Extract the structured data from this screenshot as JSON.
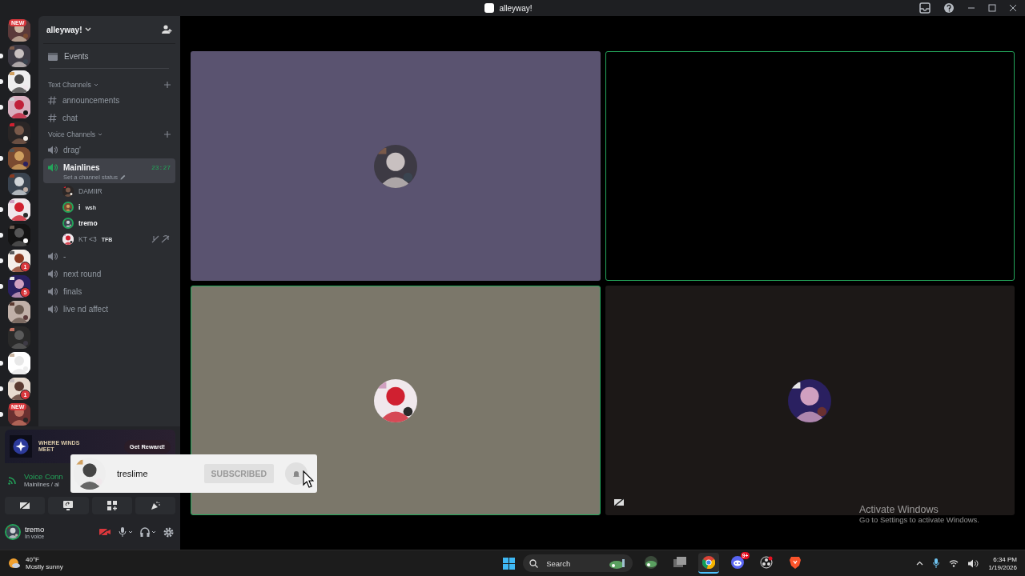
{
  "window": {
    "title": "alleyway!"
  },
  "servers": [
    {
      "badge": {
        "kind": "pill",
        "text": "NEW"
      },
      "unread": false
    },
    {
      "unread": true
    },
    {
      "unread": true
    },
    {
      "unread": true
    },
    {
      "unread": false
    },
    {
      "unread": true
    },
    {
      "unread": false
    },
    {
      "unread": true
    },
    {
      "unread": true
    },
    {
      "badge": {
        "kind": "count",
        "text": "1"
      },
      "unread": true
    },
    {
      "badge": {
        "kind": "count",
        "text": "5"
      },
      "unread": true
    },
    {
      "unread": false
    },
    {
      "unread": false
    },
    {
      "unread": true
    },
    {
      "badge": {
        "kind": "count",
        "text": "1"
      },
      "unread": true
    },
    {
      "badge": {
        "kind": "pill",
        "text": "NEW"
      },
      "unread": true
    }
  ],
  "sidebar": {
    "server_name": "alleyway!",
    "events": "Events",
    "categories": [
      {
        "name": "Text Channels",
        "channels": [
          {
            "kind": "text",
            "name": "announcements",
            "selected": false
          },
          {
            "kind": "text",
            "name": "chat",
            "selected": false
          }
        ]
      },
      {
        "name": "Voice Channels",
        "channels": [
          {
            "kind": "voice",
            "name": "drag'",
            "selected": false
          },
          {
            "kind": "voice",
            "name": "Mainlines",
            "selected": true,
            "timer": "23:27",
            "status": "Set a channel status",
            "members": [
              {
                "name": "DAMIIR",
                "speaking": false,
                "muted": false
              },
              {
                "name": "i",
                "tag": "wsh",
                "speaking": true,
                "muted": false
              },
              {
                "name": "tremo",
                "speaking": true,
                "muted": false
              },
              {
                "name": "KT <3",
                "tag": "TFB",
                "speaking": false,
                "muted": true
              }
            ]
          },
          {
            "kind": "voice",
            "name": "-",
            "selected": false
          },
          {
            "kind": "voice",
            "name": "next round",
            "selected": false
          },
          {
            "kind": "voice",
            "name": "finals",
            "selected": false
          },
          {
            "kind": "voice",
            "name": "live nd affect",
            "selected": false
          }
        ]
      }
    ]
  },
  "promo": {
    "logo": "WHERE WINDS MEET",
    "button": "Get Reward!"
  },
  "voice_panel": {
    "title": "Voice Conn",
    "subtitle": "Mainlines / al"
  },
  "user_panel": {
    "name": "tremo",
    "status": "In voice",
    "camera_off": true
  },
  "tiles": [
    {
      "color": "#5a5370",
      "speaking": false,
      "avatar": true,
      "camera_muted": false
    },
    {
      "color": "#000000",
      "speaking": true,
      "avatar": false,
      "camera_muted": false
    },
    {
      "color": "#7b776a",
      "speaking": true,
      "avatar": true,
      "camera_muted": false
    },
    {
      "color": "#1c1817",
      "speaking": false,
      "avatar": true,
      "camera_muted": true
    }
  ],
  "subscribe_popup": {
    "name": "treslime",
    "button": "SUBSCRIBED"
  },
  "activation": {
    "title": "Activate Windows",
    "subtitle": "Go to Settings to activate Windows."
  },
  "taskbar": {
    "temperature": "40°F",
    "weather": "Mostly sunny",
    "search_placeholder": "Search",
    "apps": [
      {
        "kind": "widget",
        "active": false
      },
      {
        "kind": "files",
        "active": false
      },
      {
        "kind": "chrome",
        "active": true
      },
      {
        "kind": "discord",
        "badge": "9+",
        "active": false
      },
      {
        "kind": "obs",
        "active": false
      },
      {
        "kind": "brave",
        "active": false
      }
    ],
    "time": "6:34 PM",
    "date": "1/19/2026"
  }
}
